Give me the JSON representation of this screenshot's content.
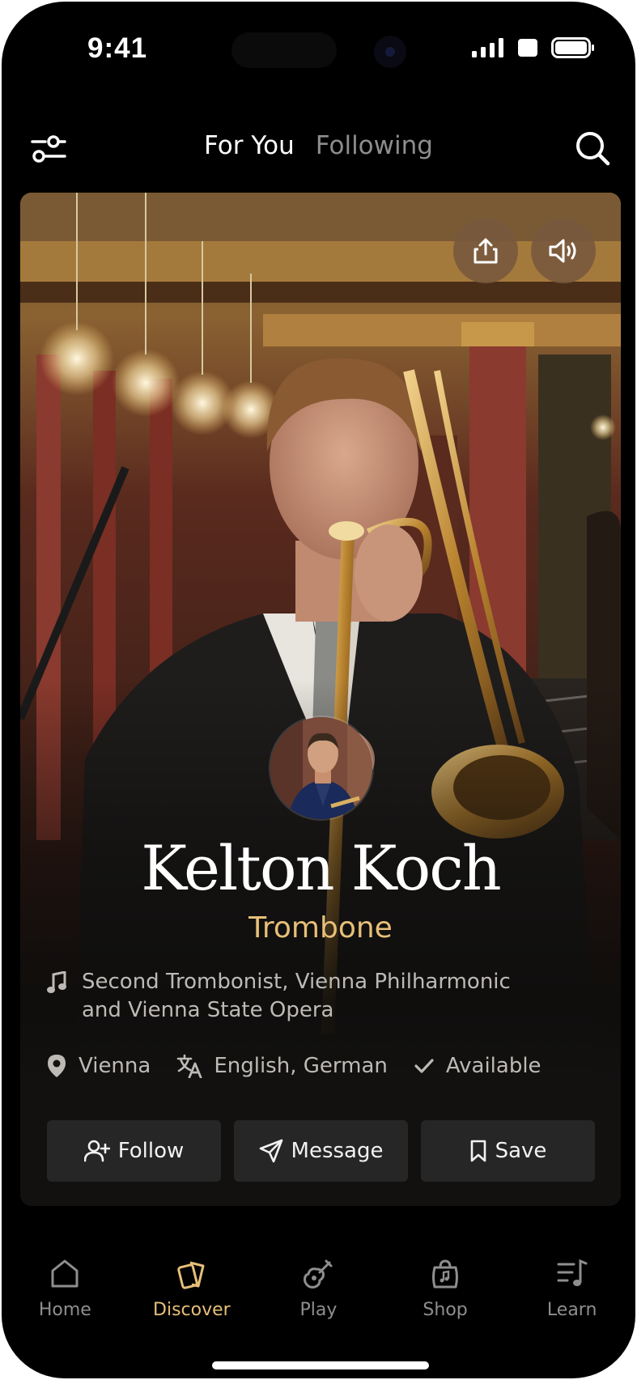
{
  "status_bar": {
    "time": "9:41"
  },
  "top_nav": {
    "tabs": [
      {
        "label": "For You",
        "active": true
      },
      {
        "label": "Following",
        "active": false
      }
    ]
  },
  "profile": {
    "name": "Kelton Koch",
    "instrument": "Trombone",
    "bio": "Second Trombonist, Vienna Philharmonic and Vienna State Opera",
    "location": "Vienna",
    "languages": "English, German",
    "availability": "Available"
  },
  "actions": {
    "follow": "Follow",
    "message": "Message",
    "save": "Save"
  },
  "tabbar": {
    "items": [
      {
        "label": "Home",
        "icon": "home-icon",
        "active": false
      },
      {
        "label": "Discover",
        "icon": "cards-icon",
        "active": true
      },
      {
        "label": "Play",
        "icon": "guitar-icon",
        "active": false
      },
      {
        "label": "Shop",
        "icon": "bag-icon",
        "active": false
      },
      {
        "label": "Learn",
        "icon": "music-list-icon",
        "active": false
      }
    ]
  },
  "colors": {
    "accent": "#e6bf78",
    "background": "#000000",
    "button": "#262626",
    "muted_text": "#8d8d8d"
  }
}
